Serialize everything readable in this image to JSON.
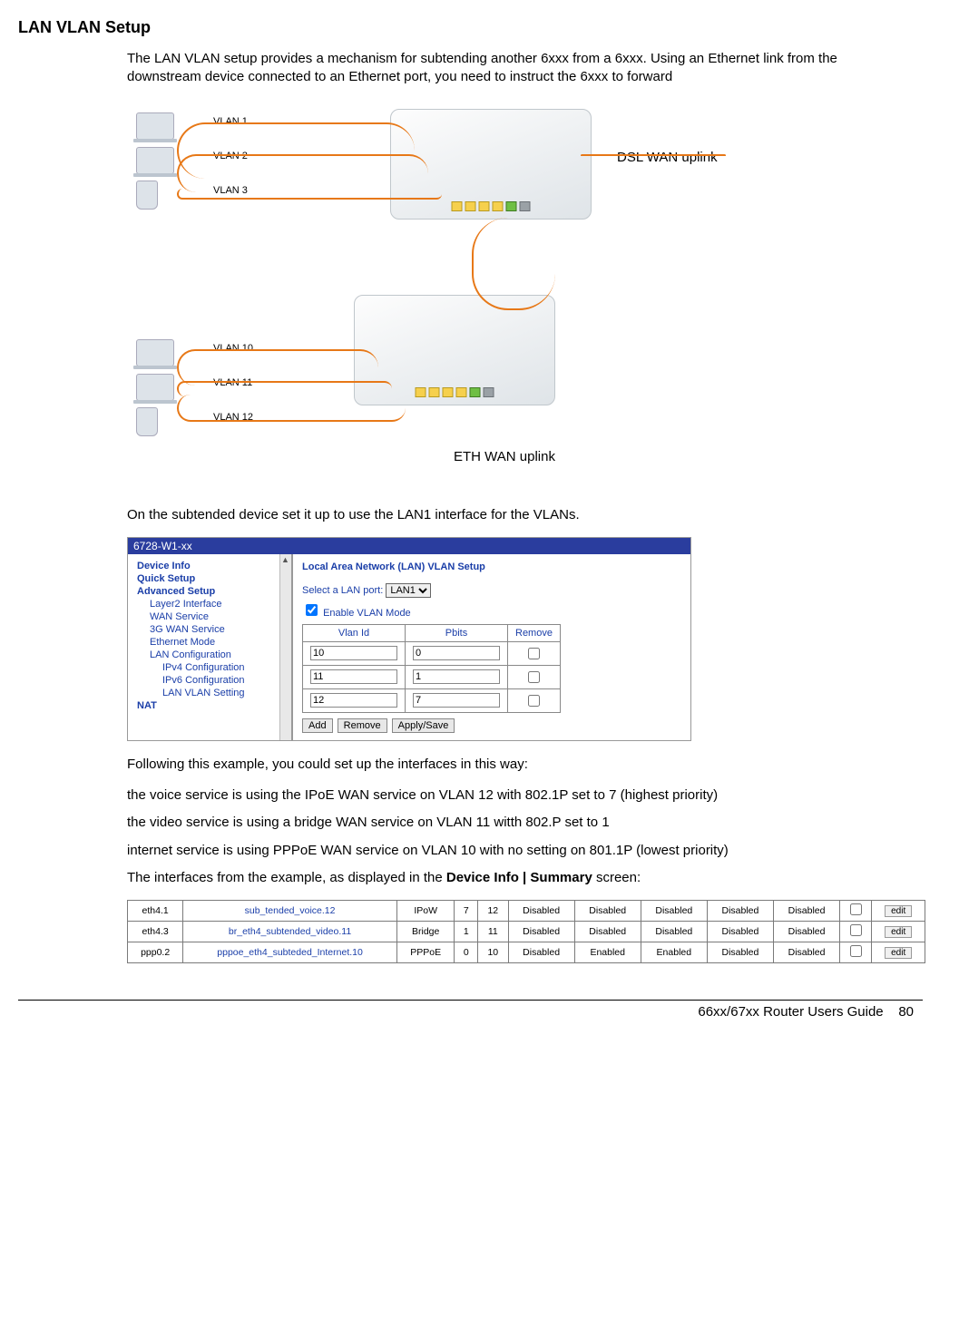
{
  "title": "LAN VLAN Setup",
  "intro": "The LAN VLAN setup provides a mechanism for subtending another 6xxx from a 6xxx. Using an Ethernet link from the downstream device connected to an Ethernet port, you need to instruct the 6xxx to forward",
  "diagram": {
    "top_vlans": [
      "VLAN 1",
      "VLAN 2",
      "VLAN 3"
    ],
    "bottom_vlans": [
      "VLAN 10",
      "VLAN 11",
      "VLAN 12"
    ],
    "top_annot": "DSL WAN uplink",
    "bottom_annot": "ETH WAN uplink"
  },
  "after_diagram": "On the subtended device set it up to use the LAN1 interface for the VLANs.",
  "ss1": {
    "header": "6728-W1-xx",
    "nav": [
      {
        "lvl": 1,
        "label": "Device Info"
      },
      {
        "lvl": 1,
        "label": "Quick Setup"
      },
      {
        "lvl": 1,
        "label": "Advanced Setup"
      },
      {
        "lvl": 2,
        "label": "Layer2 Interface"
      },
      {
        "lvl": 2,
        "label": "WAN Service"
      },
      {
        "lvl": 2,
        "label": "3G WAN Service"
      },
      {
        "lvl": 2,
        "label": "Ethernet Mode"
      },
      {
        "lvl": 2,
        "label": "LAN Configuration"
      },
      {
        "lvl": 3,
        "label": "IPv4 Configuration"
      },
      {
        "lvl": 3,
        "label": "IPv6 Configuration"
      },
      {
        "lvl": 3,
        "label": "LAN VLAN Setting"
      },
      {
        "lvl": 1,
        "label": "NAT"
      }
    ],
    "main_title": "Local Area Network (LAN) VLAN Setup",
    "select_label": "Select a LAN port:",
    "select_value": "LAN1",
    "enable_label": "Enable VLAN Mode",
    "cols": [
      "Vlan Id",
      "Pbits",
      "Remove"
    ],
    "rows": [
      {
        "id": "10",
        "p": "0"
      },
      {
        "id": "11",
        "p": "1"
      },
      {
        "id": "12",
        "p": "7"
      }
    ],
    "buttons": [
      "Add",
      "Remove",
      "Apply/Save"
    ]
  },
  "after_ss1": "Following this example, you could set up the interfaces in this way:",
  "bullets": [
    "the voice service is using the IPoE WAN service on VLAN 12 with 802.1P set to 7 (highest priority)",
    "the video service is using a bridge WAN service on VLAN 11 witth 802.P set to 1",
    "internet service is using PPPoE WAN service on VLAN 10 with no setting on 801.1P (lowest priority)"
  ],
  "before_ss2_a": "The interfaces from the example, as displayed in the ",
  "before_ss2_b": "Device Info | Summary",
  "before_ss2_c": " screen:",
  "ss2": {
    "rows": [
      [
        "eth4.1",
        "sub_tended_voice.12",
        "IPoW",
        "7",
        "12",
        "Disabled",
        "Disabled",
        "Disabled",
        "Disabled",
        "Disabled"
      ],
      [
        "eth4.3",
        "br_eth4_subtended_video.11",
        "Bridge",
        "1",
        "11",
        "Disabled",
        "Disabled",
        "Disabled",
        "Disabled",
        "Disabled"
      ],
      [
        "ppp0.2",
        "pppoe_eth4_subteded_Internet.10",
        "PPPoE",
        "0",
        "10",
        "Disabled",
        "Enabled",
        "Enabled",
        "Disabled",
        "Disabled"
      ]
    ],
    "edit_label": "edit"
  },
  "footer_guide": "66xx/67xx Router Users Guide",
  "footer_page": "80"
}
